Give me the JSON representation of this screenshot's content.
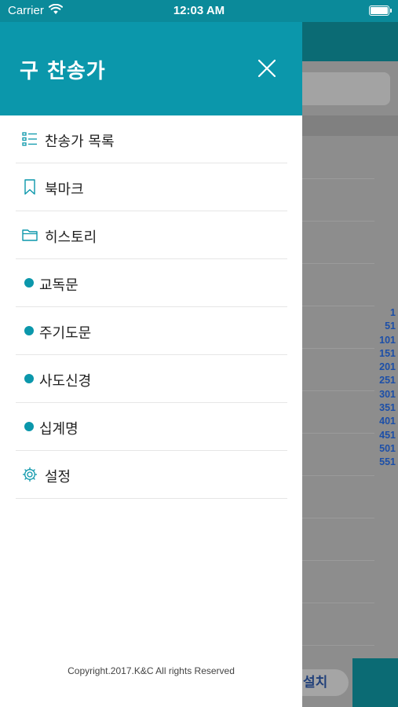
{
  "status_bar": {
    "carrier": "Carrier",
    "time": "12:03 AM"
  },
  "drawer": {
    "title": "구 찬송가",
    "close_icon": "close-icon",
    "accent_color": "#0b97ab",
    "menu_items": [
      {
        "label": "찬송가 목록",
        "icon": "list-icon"
      },
      {
        "label": "북마크",
        "icon": "bookmark-icon"
      },
      {
        "label": "히스토리",
        "icon": "folder-icon"
      },
      {
        "label": "교독문",
        "icon": "dot-icon"
      },
      {
        "label": "주기도문",
        "icon": "dot-icon"
      },
      {
        "label": "사도신경",
        "icon": "dot-icon"
      },
      {
        "label": "십계명",
        "icon": "dot-icon"
      },
      {
        "label": "설정",
        "icon": "gear-icon"
      }
    ],
    "copyright": "Copyright.2017.K&C All rights Reserved"
  },
  "background": {
    "index": [
      "1",
      "51",
      "101",
      "151",
      "201",
      "251",
      "301",
      "351",
      "401",
      "451",
      "501",
      "551"
    ],
    "install_label": "설치"
  }
}
